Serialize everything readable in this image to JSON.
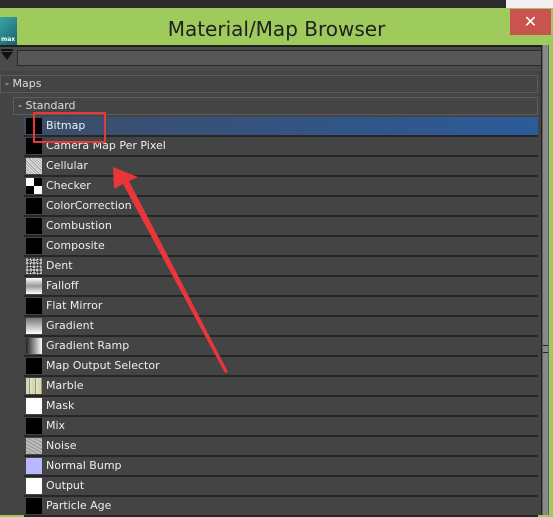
{
  "window": {
    "title": "Material/Map Browser",
    "app_icon_label": "max",
    "close_glyph": "✕"
  },
  "filter": {
    "value": "",
    "placeholder": ""
  },
  "tree": {
    "group": {
      "toggle": "-",
      "label": "Maps"
    },
    "subgroup": {
      "toggle": "-",
      "label": "Standard"
    },
    "items": [
      {
        "label": "Bitmap",
        "swatch": "black",
        "selected": true
      },
      {
        "label": "Camera Map Per Pixel",
        "swatch": "black",
        "selected": false
      },
      {
        "label": "Cellular",
        "swatch": "cellular-noise",
        "selected": false
      },
      {
        "label": "Checker",
        "swatch": "checker",
        "selected": false
      },
      {
        "label": "ColorCorrection",
        "swatch": "black",
        "selected": false
      },
      {
        "label": "Combustion",
        "swatch": "black",
        "selected": false
      },
      {
        "label": "Composite",
        "swatch": "black",
        "selected": false
      },
      {
        "label": "Dent",
        "swatch": "dent-noise",
        "selected": false
      },
      {
        "label": "Falloff",
        "swatch": "falloff-gradient",
        "selected": false
      },
      {
        "label": "Flat Mirror",
        "swatch": "black",
        "selected": false
      },
      {
        "label": "Gradient",
        "swatch": "vertical-gradient",
        "selected": false
      },
      {
        "label": "Gradient Ramp",
        "swatch": "horizontal-gradient",
        "selected": false
      },
      {
        "label": "Map Output Selector",
        "swatch": "black",
        "selected": false
      },
      {
        "label": "Marble",
        "swatch": "marble",
        "selected": false
      },
      {
        "label": "Mask",
        "swatch": "white",
        "selected": false
      },
      {
        "label": "Mix",
        "swatch": "black",
        "selected": false
      },
      {
        "label": "Noise",
        "swatch": "gray-noise",
        "selected": false
      },
      {
        "label": "Normal Bump",
        "swatch": "lavender",
        "selected": false
      },
      {
        "label": "Output",
        "swatch": "white",
        "selected": false
      },
      {
        "label": "Particle Age",
        "swatch": "black",
        "selected": false
      }
    ]
  },
  "annotation": {
    "highlight_color": "#e8363a",
    "arrow_color": "#e8363a"
  },
  "colors": {
    "titlebar": "#9ecb5c",
    "close": "#c9534f",
    "selection": "#2c5b9a"
  }
}
